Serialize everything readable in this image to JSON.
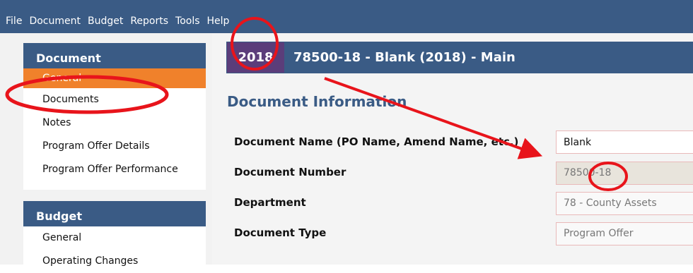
{
  "menu": [
    "File",
    "Document",
    "Budget",
    "Reports",
    "Tools",
    "Help"
  ],
  "sidebar": {
    "document": {
      "header": "Document",
      "items": [
        "General",
        "Documents",
        "Notes",
        "Program Offer Details",
        "Program Offer Performance"
      ],
      "active": "General"
    },
    "budget": {
      "header": "Budget",
      "items": [
        "General",
        "Operating Changes"
      ]
    }
  },
  "titlebar": {
    "year": "2018",
    "title": "78500-18 - Blank (2018) - Main"
  },
  "section_title": "Document Information",
  "fields": [
    {
      "label": "Document Name (PO Name, Amend Name, etc.)",
      "value": "Blank"
    },
    {
      "label": "Document Number",
      "value": "78500-18"
    },
    {
      "label": "Department",
      "value": "78 - County Assets"
    },
    {
      "label": "Document Type",
      "value": "Program Offer"
    }
  ],
  "colors": {
    "header_blue": "#3a5b85",
    "year_purple": "#5b3d7a",
    "active_orange": "#f0812b",
    "annotation_red": "#e8141b"
  }
}
